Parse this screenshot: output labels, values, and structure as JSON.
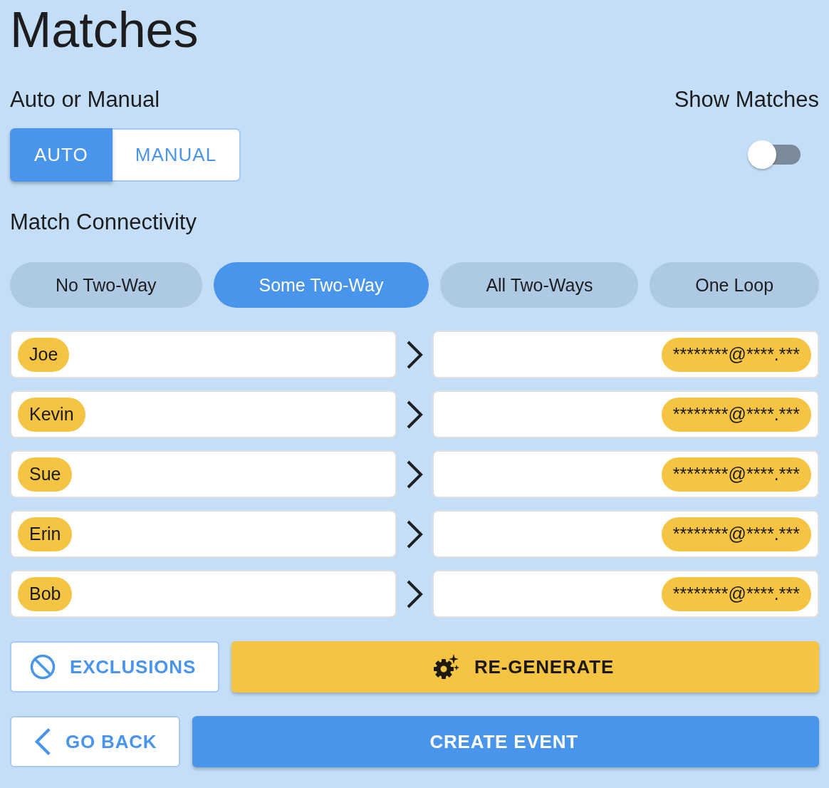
{
  "title": "Matches",
  "mode": {
    "label": "Auto or Manual",
    "options": [
      {
        "label": "AUTO",
        "selected": true
      },
      {
        "label": "MANUAL",
        "selected": false
      }
    ]
  },
  "show_matches": {
    "label": "Show Matches",
    "on": false
  },
  "connectivity": {
    "label": "Match Connectivity",
    "options": [
      {
        "label": "No Two-Way",
        "selected": false
      },
      {
        "label": "Some Two-Way",
        "selected": true
      },
      {
        "label": "All Two-Ways",
        "selected": false
      },
      {
        "label": "One Loop",
        "selected": false
      }
    ]
  },
  "matches": [
    {
      "giver": "Joe",
      "receiver": "********@****.***"
    },
    {
      "giver": "Kevin",
      "receiver": "********@****.***"
    },
    {
      "giver": "Sue",
      "receiver": "********@****.***"
    },
    {
      "giver": "Erin",
      "receiver": "********@****.***"
    },
    {
      "giver": "Bob",
      "receiver": "********@****.***"
    }
  ],
  "action_rows": [
    {
      "buttons": [
        {
          "kind": "exclusions",
          "label": "EXCLUSIONS"
        },
        {
          "kind": "regenerate",
          "label": "RE-GENERATE"
        }
      ]
    },
    {
      "buttons": [
        {
          "kind": "back",
          "label": "GO BACK"
        },
        {
          "kind": "create",
          "label": "CREATE EVENT"
        }
      ]
    }
  ]
}
